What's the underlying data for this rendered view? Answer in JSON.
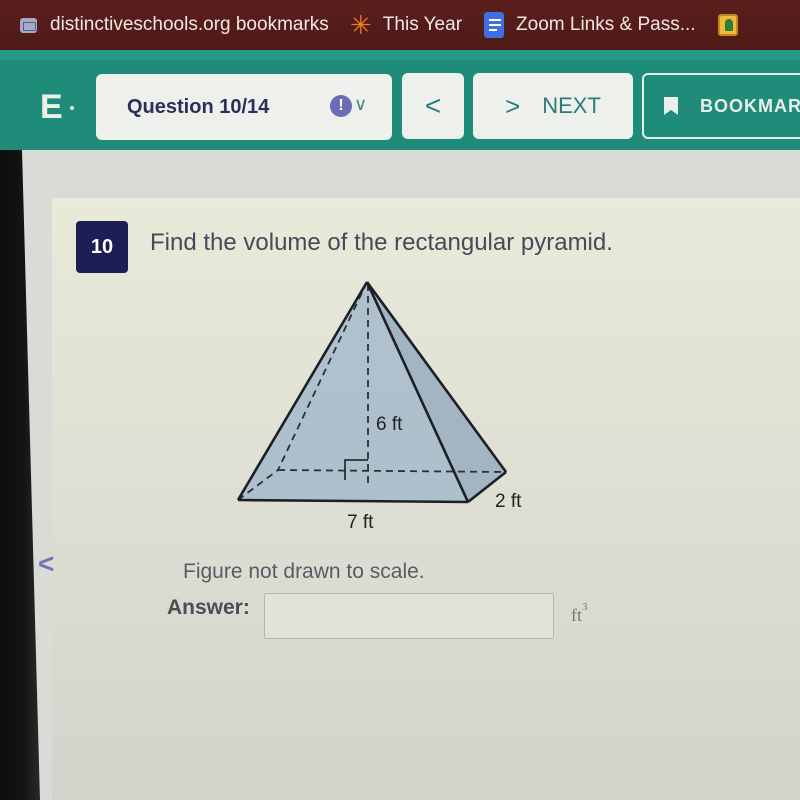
{
  "bookmarks": [
    {
      "icon": "folder-icon",
      "label": "distinctiveschools.org bookmarks"
    },
    {
      "icon": "spark-icon",
      "label": "This Year"
    },
    {
      "icon": "doc-icon",
      "label": "Zoom Links & Pass..."
    },
    {
      "icon": "person-icon",
      "label": ""
    }
  ],
  "header": {
    "brand": "E",
    "question_selector": "Question 10/14",
    "flag_glyph": "!",
    "prev_glyph": "<",
    "next_glyph": ">",
    "next_label": "NEXT",
    "bookmark_label": "BOOKMAR"
  },
  "question": {
    "number": "10",
    "prompt": "Find the volume of the rectangular pyramid.",
    "figure": {
      "height_label": "6 ft",
      "length_label": "7 ft",
      "width_label": "2 ft"
    },
    "note": "Figure  not drawn to scale.",
    "answer_label": "Answer:",
    "answer_value": "",
    "answer_placeholder": "",
    "unit": "ft",
    "unit_exponent": "3"
  },
  "side_nav": {
    "prev_glyph": "<"
  },
  "colors": {
    "bookmarks_bar": "#521c1a",
    "header_teal": "#1f8b79",
    "badge_navy": "#1c1f55",
    "pyramid_fill": "#a9bccb"
  }
}
